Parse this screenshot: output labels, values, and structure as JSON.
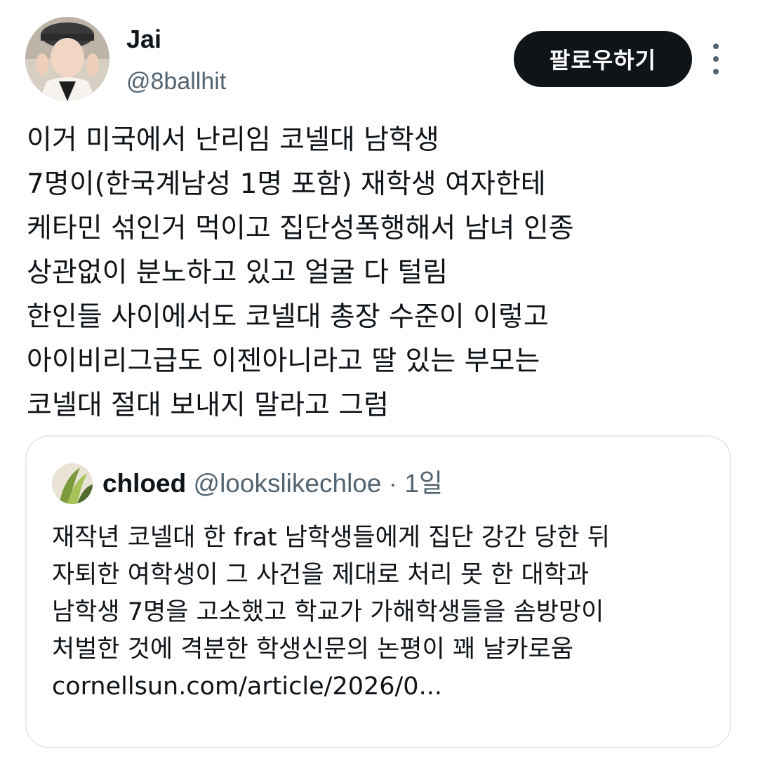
{
  "author": {
    "name": "Jai",
    "handle": "@8ballhit"
  },
  "actions": {
    "follow_label": "팔로우하기"
  },
  "tweet": {
    "text": "이거 미국에서 난리임 코넬대 남학생\n7명이(한국계남성 1명 포함) 재학생 여자한테\n케타민 섞인거 먹이고 집단성폭행해서 남녀 인종\n상관없이 분노하고 있고 얼굴 다 털림\n한인들 사이에서도 코넬대 총장 수준이 이렇고\n아이비리그급도 이젠아니라고 딸 있는 부모는\n코넬대 절대 보내지 말라고 그럼"
  },
  "quote": {
    "name": "chloed",
    "handle": "@lookslikechloe",
    "separator": "·",
    "time": "1일",
    "text": "재작년 코넬대 한 frat 남학생들에게 집단 강간 당한 뒤\n자퇴한 여학생이 그 사건을 제대로 처리 못 한 대학과\n남학생 7명을 고소했고 학교가 가해학생들을 솜방망이\n처벌한 것에 격분한 학생신문의 논평이 꽤 날카로움\ncornellsun.com/article/2026/0..."
  },
  "icons": {
    "more": "more-vertical-icon",
    "avatar": "avatar-photo",
    "quote_avatar": "quote-avatar-photo"
  },
  "colors": {
    "text": "#0f1419",
    "secondary": "#536471",
    "button_bg": "#0f1419",
    "border": "#e6e9ec"
  }
}
